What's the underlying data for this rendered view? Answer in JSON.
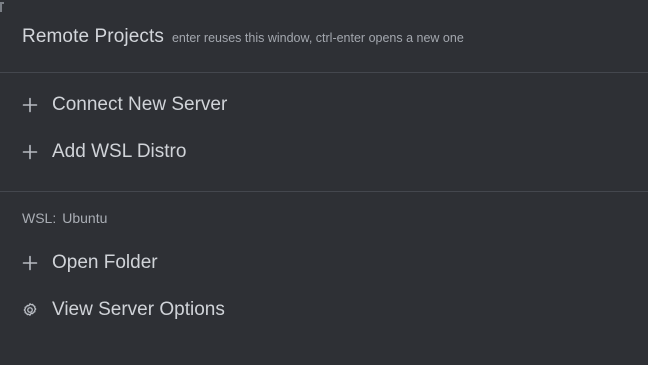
{
  "header": {
    "title": "Remote Projects",
    "hint": "enter reuses this window, ctrl-enter opens a new one"
  },
  "actions": {
    "connect_label": "Connect New Server",
    "add_wsl_label": "Add WSL Distro",
    "icon": "plus-icon"
  },
  "wsl": {
    "prefix": "WSL:",
    "name": "Ubuntu",
    "open_folder_label": "Open Folder",
    "open_folder_icon": "plus-icon",
    "server_options_label": "View Server Options",
    "server_options_icon": "gear-icon"
  },
  "colors": {
    "background": "#2e3035",
    "divider": "#44474e",
    "text": "#d0d3d8",
    "muted": "#a3a7ae"
  }
}
